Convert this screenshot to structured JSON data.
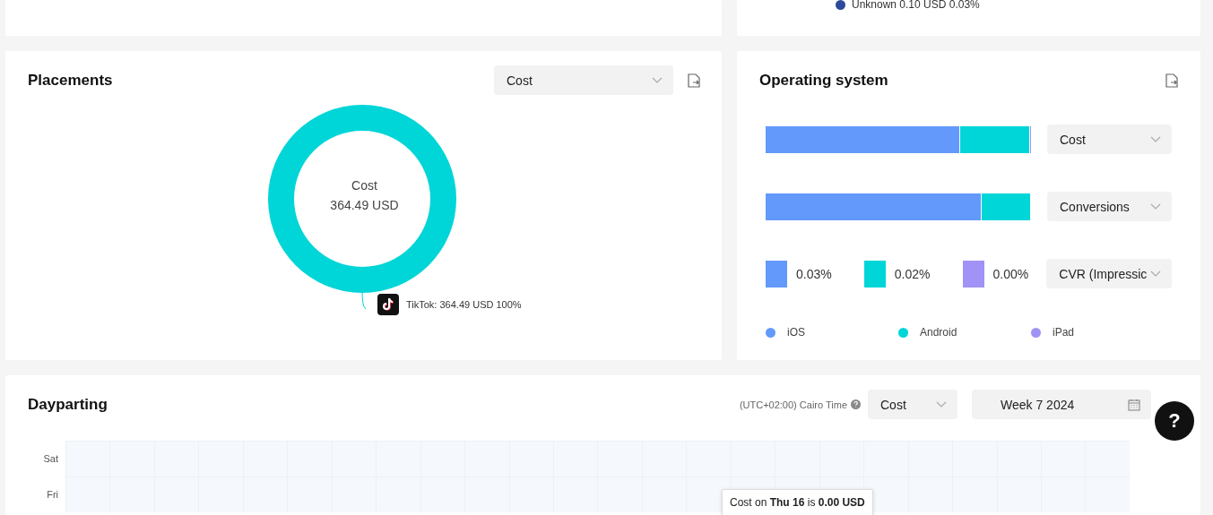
{
  "top_legend": {
    "label": "Unknown 0.10 USD 0.03%",
    "color": "#2b4a9b"
  },
  "placements": {
    "title": "Placements",
    "metric_dropdown": {
      "value": "Cost"
    },
    "donut": {
      "color": "#00d5d8"
    },
    "center_label": "Cost",
    "center_value": "364.49 USD",
    "slice_label": "TikTok: 364.49 USD 100%"
  },
  "operating_system": {
    "title": "Operating system",
    "bar_rows": [
      {
        "metric": "Cost",
        "segments": [
          {
            "level": 0.735,
            "color": "#6399fb"
          },
          {
            "level": 0.26,
            "color": "#00d5d8"
          },
          {
            "level": 0.005,
            "color": "#a093f5"
          }
        ]
      },
      {
        "metric": "Conversions",
        "segments": [
          {
            "level": 0.815,
            "color": "#6399fb"
          },
          {
            "level": 0.185,
            "color": "#00d5d8"
          }
        ]
      }
    ],
    "rate_row": {
      "metric": "CVR (Impressic",
      "values": [
        {
          "text": "0.03%",
          "color": "#6399fb"
        },
        {
          "text": "0.02%",
          "color": "#00d5d8"
        },
        {
          "text": "0.00%",
          "color": "#a093f5"
        }
      ]
    },
    "legend": [
      {
        "label": "iOS",
        "color": "#6399fb"
      },
      {
        "label": "Android",
        "color": "#00d5d8"
      },
      {
        "label": "iPad",
        "color": "#a093f5"
      }
    ]
  },
  "dayparting": {
    "title": "Dayparting",
    "timezone": "(UTC+02:00) Cairo Time",
    "metric_dropdown": {
      "value": "Cost"
    },
    "week_picker": {
      "value": "Week 7 2024"
    },
    "rows": [
      "Sat",
      "Fri"
    ],
    "tooltip": "Cost on **Thu 16** is **0.00 USD**"
  },
  "help_button": {
    "label": "?"
  }
}
